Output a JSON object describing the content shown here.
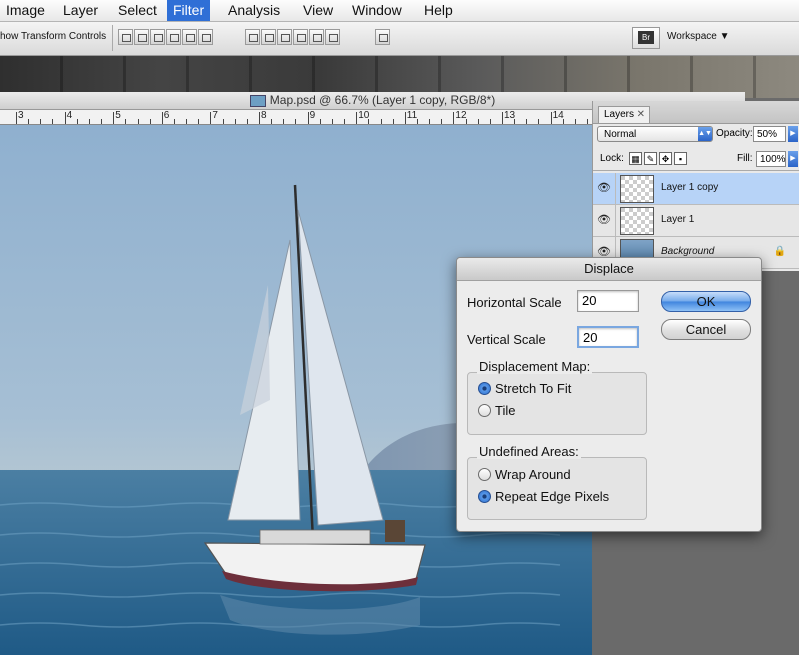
{
  "menubar": {
    "items": [
      "Image",
      "Layer",
      "Select",
      "Filter",
      "Analysis",
      "View",
      "Window",
      "Help"
    ],
    "active": "Filter"
  },
  "options_bar": {
    "show_transform_label": "how Transform Controls",
    "workspace_label": "Workspace ▼",
    "bridge_label": "Br"
  },
  "document": {
    "title": "Map.psd @ 66.7% (Layer 1 copy, RGB/8*)",
    "ruler_numbers": [
      "3",
      "4",
      "5",
      "6",
      "7",
      "8",
      "9",
      "10",
      "11",
      "12",
      "13",
      "14"
    ]
  },
  "layers_panel": {
    "tab_label": "Layers",
    "blend_mode": "Normal",
    "opacity_label": "Opacity:",
    "opacity_value": "50%",
    "lock_label": "Lock:",
    "fill_label": "Fill:",
    "fill_value": "100%",
    "layers": [
      {
        "name": "Layer 1 copy",
        "selected": true
      },
      {
        "name": "Layer 1",
        "selected": false
      },
      {
        "name": "Background",
        "selected": false,
        "locked": true
      }
    ]
  },
  "displace_dialog": {
    "title": "Displace",
    "horizontal_scale_label": "Horizontal Scale",
    "horizontal_scale_value": "20",
    "vertical_scale_label": "Vertical Scale",
    "vertical_scale_value": "20",
    "ok_label": "OK",
    "cancel_label": "Cancel",
    "displacement_map_label": "Displacement Map:",
    "displacement_options": [
      "Stretch To Fit",
      "Tile"
    ],
    "displacement_selected": "Stretch To Fit",
    "undefined_areas_label": "Undefined Areas:",
    "undefined_options": [
      "Wrap Around",
      "Repeat Edge Pixels"
    ],
    "undefined_selected": "Repeat Edge Pixels"
  }
}
